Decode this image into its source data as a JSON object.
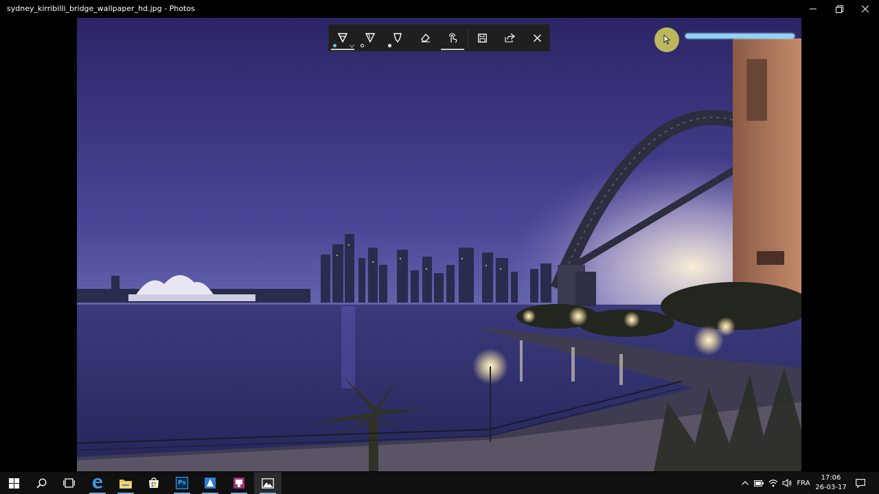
{
  "window": {
    "title": "sydney_kirribilli_bridge_wallpaper_hd.jpg - Photos",
    "controls": [
      "minimize-icon",
      "maximize-icon",
      "close-icon"
    ]
  },
  "ink_toolbar": {
    "tools": [
      {
        "name": "ballpoint-pen",
        "icon": "ballpoint-pen-icon",
        "active": true,
        "color": "#6fc3d9"
      },
      {
        "name": "pencil",
        "icon": "pencil-icon",
        "active": false,
        "color": "#1f1f1f"
      },
      {
        "name": "calligraphy-pen",
        "icon": "calligraphy-pen-icon",
        "active": false,
        "color": "#ffffff"
      },
      {
        "name": "eraser",
        "icon": "eraser-icon",
        "active": false
      },
      {
        "name": "touch-writing",
        "icon": "touch-writing-icon",
        "active": true
      }
    ],
    "actions": [
      {
        "name": "save",
        "icon": "save-icon"
      },
      {
        "name": "share",
        "icon": "share-icon"
      },
      {
        "name": "close",
        "icon": "close-icon"
      }
    ]
  },
  "overlay": {
    "slider_color": "#8fd4f7",
    "cursor_halo_color": "#d6d05a"
  },
  "taskbar": {
    "apps": [
      {
        "name": "start",
        "icon": "windows-start-icon"
      },
      {
        "name": "search",
        "icon": "search-icon"
      },
      {
        "name": "task-view",
        "icon": "task-view-icon"
      },
      {
        "name": "edge",
        "icon": "edge-icon"
      },
      {
        "name": "file-explorer",
        "icon": "folder-icon"
      },
      {
        "name": "store",
        "icon": "store-icon"
      },
      {
        "name": "photoshop",
        "icon": "photoshop-icon",
        "label": "Ps"
      },
      {
        "name": "app-blue",
        "icon": "app-icon"
      },
      {
        "name": "app-purple",
        "icon": "app-icon"
      },
      {
        "name": "photos",
        "icon": "photos-icon"
      }
    ],
    "tray": {
      "language": "FRA",
      "time": "17:06",
      "date": "26-03-17"
    }
  }
}
